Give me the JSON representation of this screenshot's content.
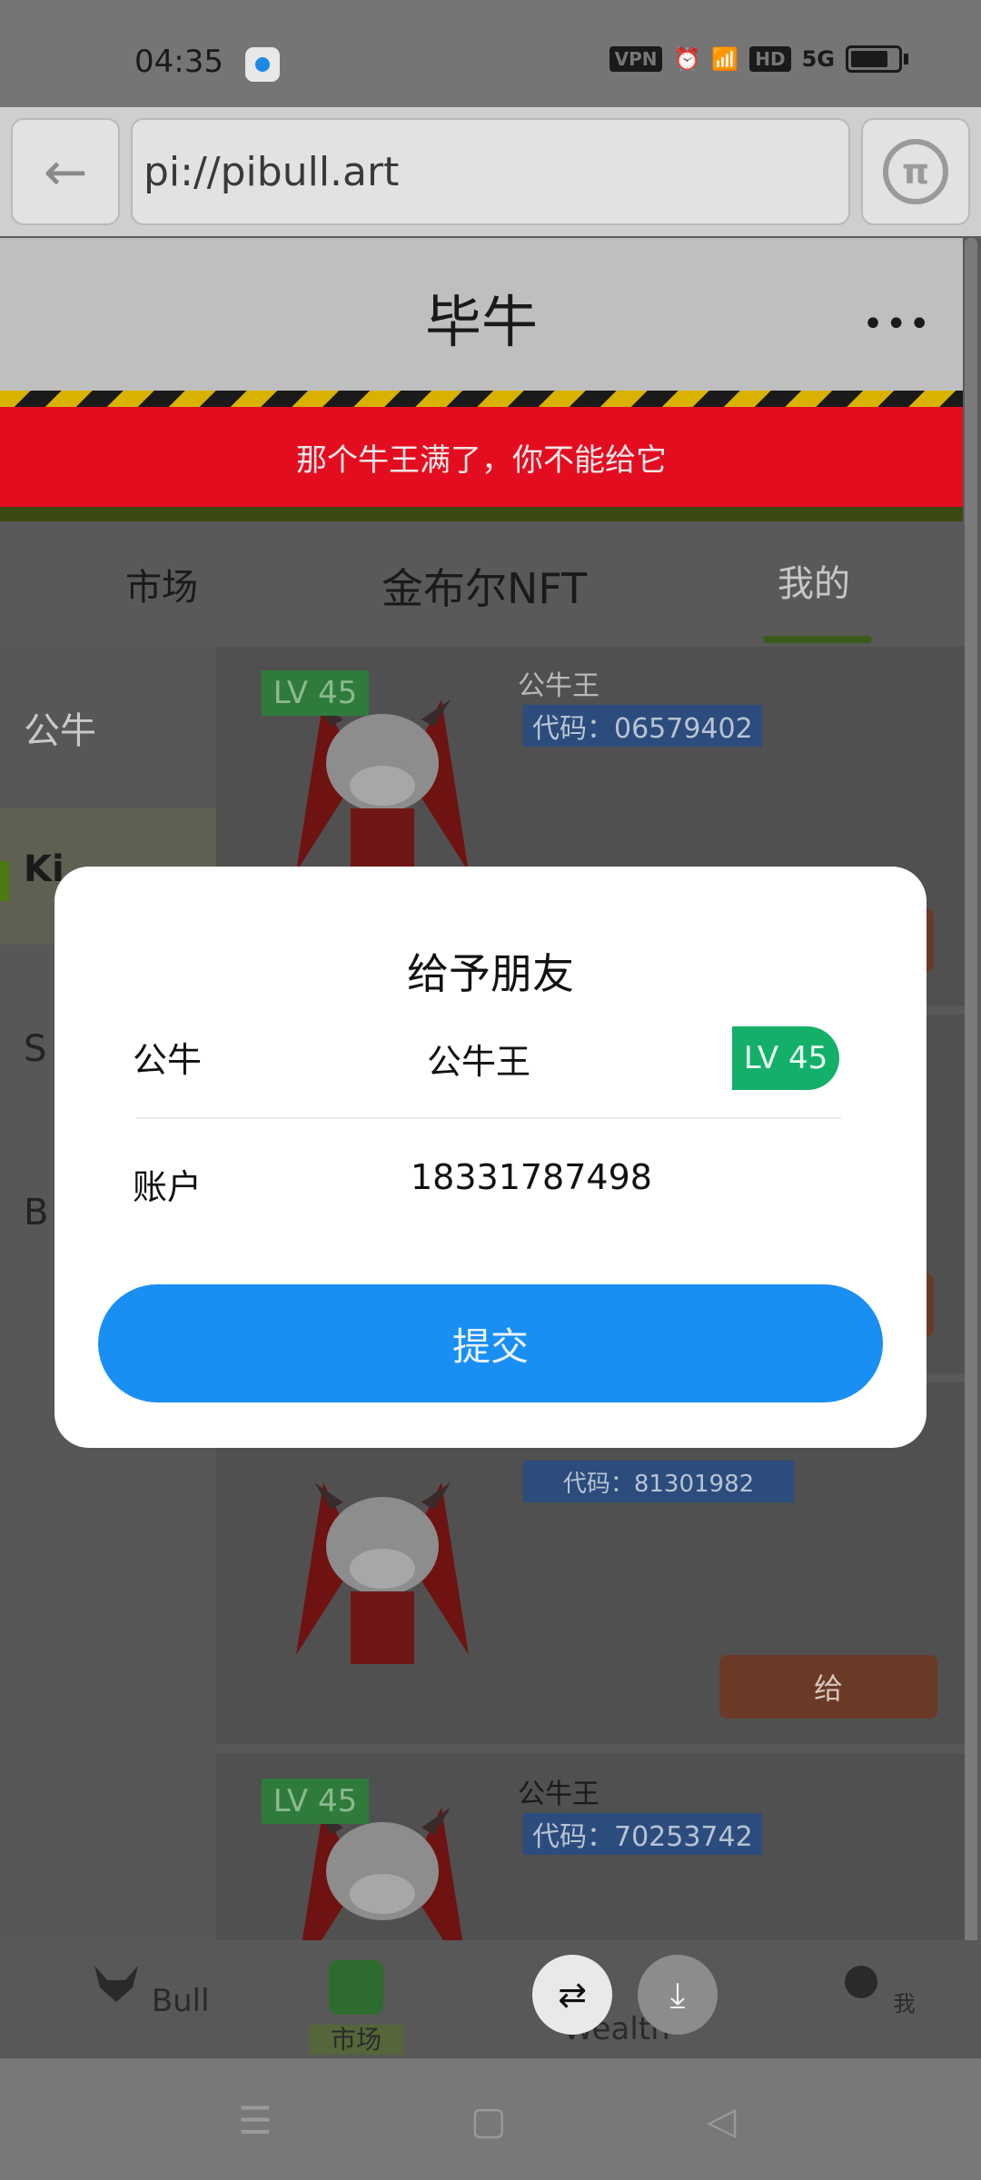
{
  "status_bar": {
    "time": "04:35",
    "icons": [
      "app-icon",
      "vpn-icon",
      "alarm-icon",
      "wifi-icon",
      "hd-icon",
      "signal-5g-icon",
      "battery-icon"
    ],
    "vpn": "VPN",
    "hd": "HD",
    "network": "5G"
  },
  "browser": {
    "url": "pi://pibull.art",
    "back_icon": "arrow-left-icon",
    "pi_icon": "pi-logo-icon",
    "pi_glyph": "π"
  },
  "header": {
    "title": "毕牛",
    "menu_icon": "more-dots-icon",
    "menu_glyph": "•••"
  },
  "alert": {
    "text": "那个牛王满了，你不能给它",
    "color": "#e40d20"
  },
  "tabs": [
    {
      "label": "市场"
    },
    {
      "label": "金布尔NFT"
    },
    {
      "label": "我的",
      "active": true
    }
  ],
  "sidebar": {
    "items": [
      {
        "label": "公牛"
      },
      {
        "label": "Ki",
        "selected": true
      },
      {
        "label": "S"
      },
      {
        "label": "B"
      }
    ]
  },
  "cards": [
    {
      "level": "LV 45",
      "name": "公牛王",
      "code": "代码：06579402"
    },
    {
      "level": "",
      "name": "",
      "code": "代码：81301982",
      "give_label": "给"
    },
    {
      "level": "LV 45",
      "name": "公牛王",
      "code": "代码：70253742"
    }
  ],
  "bottom_nav": {
    "items": [
      {
        "label": "Bull",
        "icon": "bull-head-icon"
      },
      {
        "label": "市场",
        "icon": "market-icon",
        "active": true
      },
      {
        "label": "Wealth",
        "icon": "wealth-icon"
      },
      {
        "label": "我",
        "icon": "profile-icon"
      }
    ],
    "floating": [
      {
        "icon": "translate-icon",
        "glyph": "⇄"
      },
      {
        "icon": "download-icon",
        "glyph": "⤓"
      }
    ]
  },
  "system_nav": {
    "menu_glyph": "☰",
    "home_glyph": "▢",
    "back_glyph": "◁"
  },
  "modal": {
    "title": "给予朋友",
    "bull_label": "公牛",
    "bull_value": "公牛王",
    "level": "LV 45",
    "account_label": "账户",
    "account_value": "18331787498",
    "submit_label": "提交",
    "submit_color": "#1a8ff3"
  }
}
